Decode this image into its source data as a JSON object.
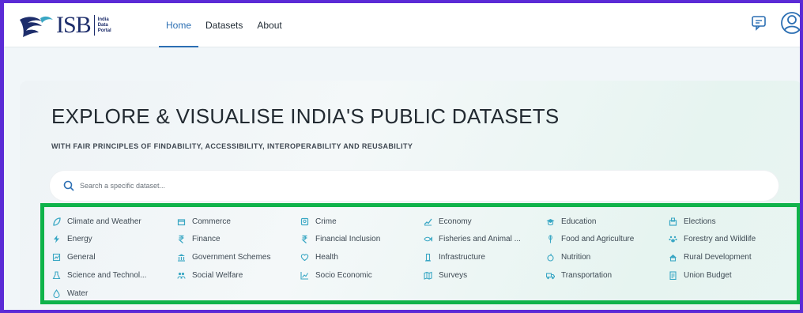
{
  "brand": {
    "name": "ISB",
    "sub": [
      "India",
      "Data",
      "Portal"
    ]
  },
  "nav": {
    "links": [
      "Home",
      "Datasets",
      "About"
    ],
    "active": "Home"
  },
  "hero": {
    "title": "EXPLORE & VISUALISE INDIA'S PUBLIC DATASETS",
    "subtitle": "WITH FAIR PRINCIPLES OF FINDABILITY, ACCESSIBILITY, INTEROPERABILITY AND REUSABILITY"
  },
  "search": {
    "placeholder": "Search a specific dataset...",
    "value": ""
  },
  "categories": [
    {
      "label": "Climate and Weather",
      "icon": "leaf-icon"
    },
    {
      "label": "Commerce",
      "icon": "storefront-icon"
    },
    {
      "label": "Crime",
      "icon": "badge-icon"
    },
    {
      "label": "Economy",
      "icon": "trend-icon"
    },
    {
      "label": "Education",
      "icon": "graduation-icon"
    },
    {
      "label": "Elections",
      "icon": "ballot-icon"
    },
    {
      "label": "Energy",
      "icon": "bolt-icon"
    },
    {
      "label": "Finance",
      "icon": "rupee-icon"
    },
    {
      "label": "Financial Inclusion",
      "icon": "rupee-icon"
    },
    {
      "label": "Fisheries and Animal ...",
      "icon": "fish-icon"
    },
    {
      "label": "Food and Agriculture",
      "icon": "wheat-icon"
    },
    {
      "label": "Forestry and Wildlife",
      "icon": "paw-icon"
    },
    {
      "label": "General",
      "icon": "chart-icon"
    },
    {
      "label": "Government Schemes",
      "icon": "building-icon"
    },
    {
      "label": "Health",
      "icon": "heart-icon"
    },
    {
      "label": "Infrastructure",
      "icon": "pillar-icon"
    },
    {
      "label": "Nutrition",
      "icon": "apple-icon"
    },
    {
      "label": "Rural Development",
      "icon": "hut-icon"
    },
    {
      "label": "Science and Technol...",
      "icon": "flask-icon"
    },
    {
      "label": "Social Welfare",
      "icon": "people-icon"
    },
    {
      "label": "Socio Economic",
      "icon": "line-chart-icon"
    },
    {
      "label": "Surveys",
      "icon": "map-icon"
    },
    {
      "label": "Transportation",
      "icon": "truck-icon"
    },
    {
      "label": "Union Budget",
      "icon": "document-icon"
    },
    {
      "label": "Water",
      "icon": "drop-icon"
    }
  ],
  "colors": {
    "accent": "#2c6fb3",
    "highlight": "#0fb34a",
    "frame": "#5b2bd6",
    "icon": "#3aa7c4"
  }
}
